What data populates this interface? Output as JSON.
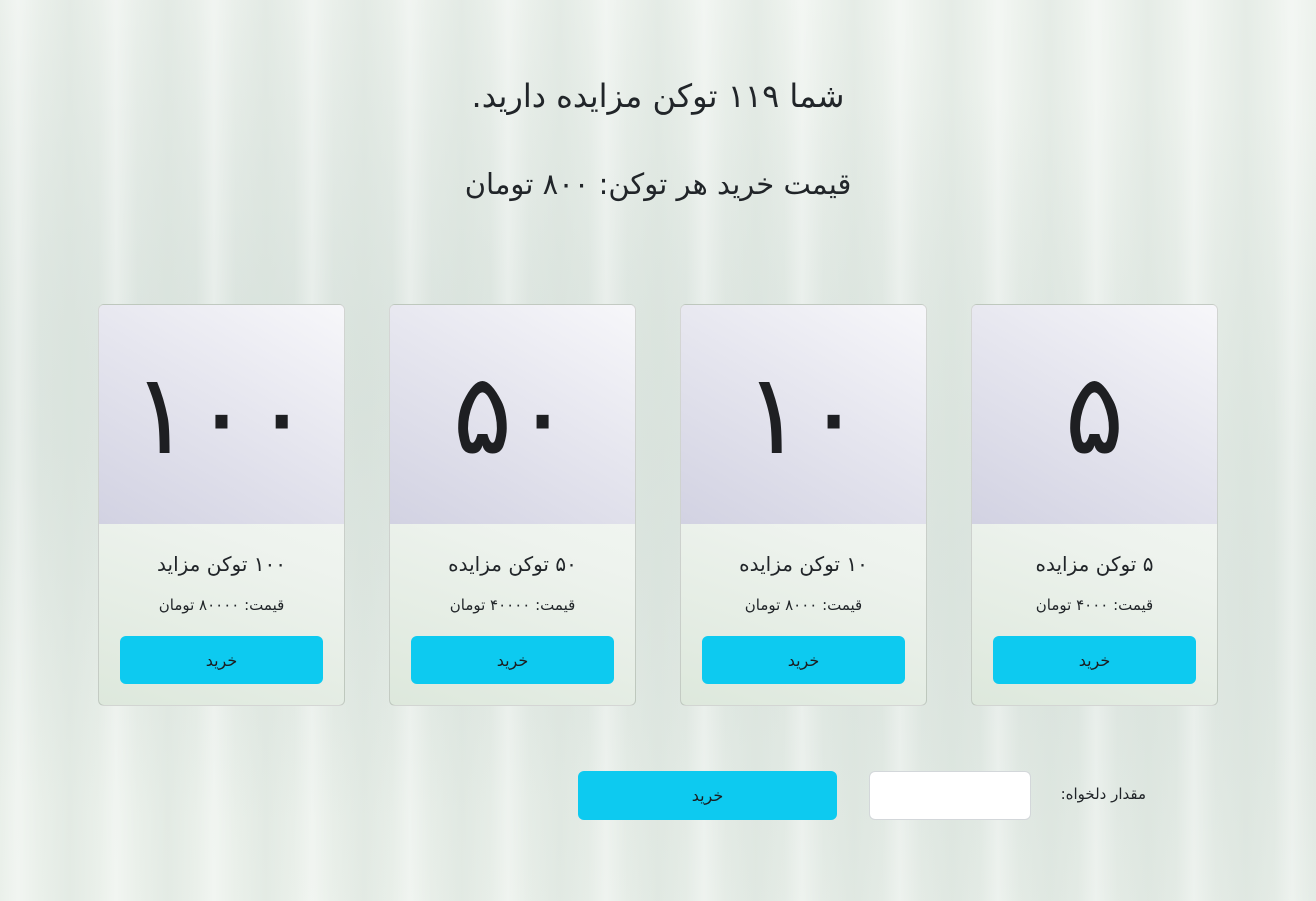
{
  "header": {
    "balance_text": "شما ۱۱۹ توکن مزایده دارید.",
    "price_text": "قیمت خرید هر توکن: ۸۰۰ تومان"
  },
  "packages": [
    {
      "number": "۵",
      "title": "۵ توکن مزایده",
      "price": "قیمت: ۴۰۰۰ تومان",
      "button": "خرید"
    },
    {
      "number": "۱۰",
      "title": "۱۰ توکن مزایده",
      "price": "قیمت: ۸۰۰۰ تومان",
      "button": "خرید"
    },
    {
      "number": "۵۰",
      "title": "۵۰ توکن مزایده",
      "price": "قیمت: ۴۰۰۰۰ تومان",
      "button": "خرید"
    },
    {
      "number": "۱۰۰",
      "title": "۱۰۰ توکن مزاید",
      "price": "قیمت: ۸۰۰۰۰ تومان",
      "button": "خرید"
    }
  ],
  "custom": {
    "label": "مقدار دلخواه:",
    "input_value": "",
    "button": "خرید"
  },
  "colors": {
    "button_bg": "#0dcaf0",
    "card_top_gradient_end": "#d2d2e2"
  }
}
